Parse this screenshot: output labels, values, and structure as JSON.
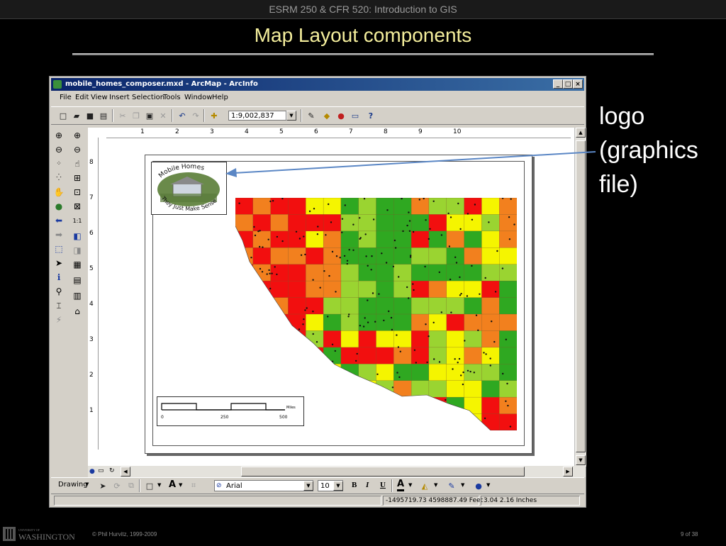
{
  "slide": {
    "course_header": "ESRM 250 & CFR 520: Introduction to GIS",
    "title": "Map Layout components",
    "annotation": "logo\n(graphics\nfile)",
    "copyright": "© Phil Hurvitz, 1999-2009",
    "page_number": "9 of 38",
    "university_logo_text": "UNIVERSITY OF WASHINGTON"
  },
  "window": {
    "title": "mobile_homes_composer.mxd - ArcMap - ArcInfo",
    "controls": {
      "minimize": "_",
      "maximize": "□",
      "close": "×"
    }
  },
  "menubar": [
    "File",
    "Edit",
    "View",
    "Insert",
    "Selection",
    "Tools",
    "Window",
    "Help"
  ],
  "standard_toolbar": {
    "scale_value": "1:9,002,837",
    "buttons": [
      "new-icon",
      "open-icon",
      "save-icon",
      "print-icon",
      "cut-icon",
      "copy-icon",
      "paste-icon",
      "delete-icon",
      "undo-icon",
      "redo-icon",
      "add-data-icon",
      "editor-icon",
      "arctoolbox-icon",
      "arccatalog-icon",
      "window-icon",
      "whats-this-icon"
    ]
  },
  "ruler_top_numbers": [
    "1",
    "2",
    "3",
    "4",
    "5",
    "6",
    "7",
    "8",
    "9",
    "10"
  ],
  "ruler_left_numbers": [
    "8",
    "7",
    "6",
    "5",
    "4",
    "3",
    "2",
    "1"
  ],
  "tools_tools": [
    "zoom-in-icon",
    "zoom-out-icon",
    "fixed-zoom-in-icon",
    "fixed-zoom-out-icon",
    "pan-icon",
    "full-extent-icon",
    "back-extent-icon",
    "forward-extent-icon",
    "select-features-icon",
    "select-elements-icon",
    "identify-icon",
    "find-icon",
    "measure-icon",
    "hyperlink-icon"
  ],
  "layout_tools": [
    "layout-zoom-in-icon",
    "layout-zoom-out-icon",
    "layout-pan-icon",
    "zoom-whole-page-icon",
    "zoom-100-icon",
    "fixed-zoom-in-layout-icon",
    "fixed-zoom-out-layout-icon",
    "layout-back-icon",
    "layout-forward-icon",
    "layout-zoom-percent-icon",
    "toggle-draft-icon",
    "focus-data-frame-icon",
    "change-layout-icon",
    "data-driven-pages-icon"
  ],
  "layout": {
    "logo": {
      "top_text": "Mobile Homes",
      "bottom_text": "They Just Make Sense"
    },
    "scalebar": {
      "labels": [
        "0",
        "250",
        "500"
      ],
      "units": "Miles"
    }
  },
  "drawing_toolbar": {
    "drawing_label": "Drawing",
    "font_name": "Arial",
    "font_size": "10",
    "bold": "B",
    "italic": "I",
    "underline": "U",
    "text_tool": "A"
  },
  "status": {
    "coordinates": "-1495719.73  4598887.49 Feet",
    "page_position": "3.04  2.16 Inches"
  },
  "colors": {
    "title_yellow": "#f4ee9c",
    "arrow_blue": "#5b87c5",
    "class_red": "#f20f0f",
    "class_orange": "#f2801e",
    "class_yellow": "#f5f500",
    "class_lightgreen": "#9ad431",
    "class_green": "#2fa821"
  }
}
